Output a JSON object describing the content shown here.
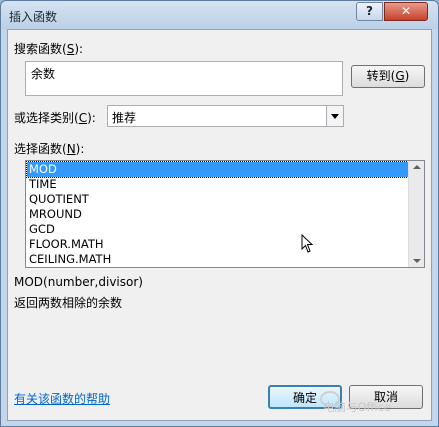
{
  "window": {
    "title": "插入函数",
    "help_glyph": "?",
    "close_glyph": "✕"
  },
  "search": {
    "label_prefix": "搜索函数(",
    "label_key": "S",
    "label_suffix": "):",
    "value": "余数",
    "goto_prefix": "转到(",
    "goto_key": "G",
    "goto_suffix": ")"
  },
  "category": {
    "label_prefix": "或选择类别(",
    "label_key": "C",
    "label_suffix": "):",
    "selected": "推荐"
  },
  "functions": {
    "label_prefix": "选择函数(",
    "label_key": "N",
    "label_suffix": "):",
    "items": [
      {
        "name": "MOD",
        "selected": true
      },
      {
        "name": "TIME",
        "selected": false
      },
      {
        "name": "QUOTIENT",
        "selected": false
      },
      {
        "name": "MROUND",
        "selected": false
      },
      {
        "name": "GCD",
        "selected": false
      },
      {
        "name": "FLOOR.MATH",
        "selected": false
      },
      {
        "name": "CEILING.MATH",
        "selected": false
      }
    ]
  },
  "description": {
    "signature": "MOD(number,divisor)",
    "text": "返回两数相除的余数"
  },
  "footer": {
    "help_link": "有关该函数的帮助",
    "ok_label": "确定",
    "cancel_label": "取消",
    "watermark": "电脑与Office"
  },
  "colors": {
    "selection": "#3399ff",
    "link": "#0066cc",
    "close_button": "#c7412d"
  }
}
